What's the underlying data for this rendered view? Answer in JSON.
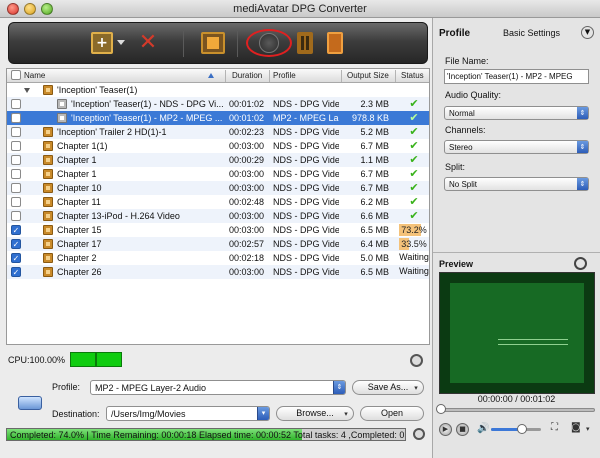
{
  "window": {
    "title": "mediAvatar DPG Converter"
  },
  "toolbar": {
    "add_icon": "add-file-icon",
    "delete_icon": "delete-icon",
    "trim_icon": "clip-icon",
    "convert_icon": "convert-icon",
    "pause_icon": "pause-icon",
    "stop_icon": "stop-icon"
  },
  "list": {
    "headers": {
      "name": "Name",
      "duration": "Duration",
      "profile": "Profile",
      "output_size": "Output Size",
      "status": "Status"
    },
    "rows": [
      {
        "name": "'Inception' Teaser(1)",
        "duration": "",
        "profile": "",
        "size": "",
        "status": "",
        "checked": null,
        "group": true
      },
      {
        "name": "'Inception' Teaser(1) - NDS - DPG Vi...",
        "duration": "00:01:02",
        "profile": "NDS - DPG Video",
        "size": "2.3 MB",
        "status": "✔",
        "checked": false,
        "child": true
      },
      {
        "name": "'Inception' Teaser(1) - MP2 - MPEG ...",
        "duration": "00:01:02",
        "profile": "MP2 - MPEG La...",
        "size": "978.8 KB",
        "status": "✔",
        "checked": false,
        "child": true,
        "selected": true
      },
      {
        "name": "'Inception' Trailer 2 HD(1)-1",
        "duration": "00:02:23",
        "profile": "NDS - DPG Video",
        "size": "5.2 MB",
        "status": "✔",
        "checked": false
      },
      {
        "name": "Chapter 1(1)",
        "duration": "00:03:00",
        "profile": "NDS - DPG Video",
        "size": "6.7 MB",
        "status": "✔",
        "checked": false
      },
      {
        "name": "Chapter 1",
        "duration": "00:00:29",
        "profile": "NDS - DPG Video",
        "size": "1.1 MB",
        "status": "✔",
        "checked": false
      },
      {
        "name": "Chapter 1",
        "duration": "00:03:00",
        "profile": "NDS - DPG Video",
        "size": "6.7 MB",
        "status": "✔",
        "checked": false
      },
      {
        "name": "Chapter 10",
        "duration": "00:03:00",
        "profile": "NDS - DPG Video",
        "size": "6.7 MB",
        "status": "✔",
        "checked": false
      },
      {
        "name": "Chapter 11",
        "duration": "00:02:48",
        "profile": "NDS - DPG Video",
        "size": "6.2 MB",
        "status": "✔",
        "checked": false
      },
      {
        "name": "Chapter 13-iPod - H.264 Video",
        "duration": "00:03:00",
        "profile": "NDS - DPG Video",
        "size": "6.6 MB",
        "status": "✔",
        "checked": false
      },
      {
        "name": "Chapter 15",
        "duration": "00:03:00",
        "profile": "NDS - DPG Video",
        "size": "6.5 MB",
        "status": "73.2%",
        "progress": 0.732,
        "checked": true
      },
      {
        "name": "Chapter 17",
        "duration": "00:02:57",
        "profile": "NDS - DPG Video",
        "size": "6.4 MB",
        "status": "33.5%",
        "progress": 0.335,
        "checked": true
      },
      {
        "name": "Chapter 2",
        "duration": "00:02:18",
        "profile": "NDS - DPG Video",
        "size": "5.0 MB",
        "status": "Waiting",
        "checked": true
      },
      {
        "name": "Chapter 26",
        "duration": "00:03:00",
        "profile": "NDS - DPG Video",
        "size": "6.5 MB",
        "status": "Waiting",
        "checked": true
      }
    ]
  },
  "cpu": {
    "label": "CPU:100.00%",
    "usage": 1.0
  },
  "bottom": {
    "profile_label": "Profile:",
    "profile_value": "MP2 - MPEG Layer-2 Audio",
    "save_as": "Save As...",
    "destination_label": "Destination:",
    "destination_value": "/Users/Img/Movies",
    "browse": "Browse...",
    "open": "Open"
  },
  "status": {
    "text": "Completed: 74.0% | Time Remaining: 00:00:18 Elapsed time: 00:00:52 Total tasks: 4 ,Completed: 0",
    "progress": 0.74
  },
  "right_panel": {
    "title": "Profile",
    "settings_label": "Basic Settings",
    "file_name_label": "File Name:",
    "file_name_value": "'Inception' Teaser(1) - MP2 - MPEG",
    "audio_quality_label": "Audio Quality:",
    "audio_quality_value": "Normal",
    "channels_label": "Channels:",
    "channels_value": "Stereo",
    "split_label": "Split:",
    "split_value": "No Split"
  },
  "preview": {
    "title": "Preview",
    "time": "00:00:00 / 00:01:02",
    "volume": 0.6
  },
  "colors": {
    "selection": "#3b79d6",
    "progress_green": "#2fb42a",
    "status_progress": "#f4c27a",
    "check_green": "#38b21a",
    "convert_highlight": "#e02020"
  }
}
